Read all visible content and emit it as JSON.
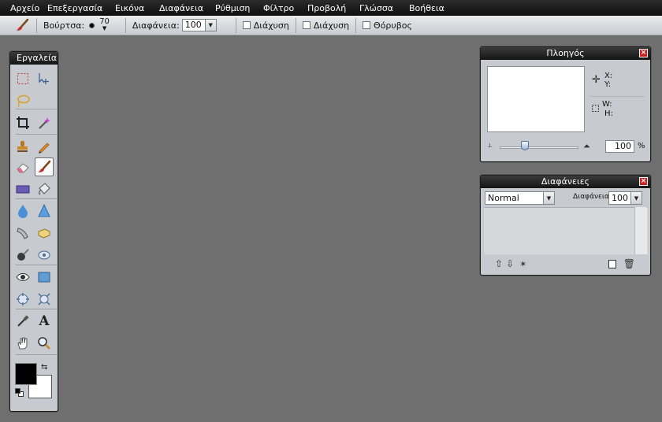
{
  "menu": [
    "Αρχείο",
    "Επεξεργασία",
    "Εικόνα",
    "Διαφάνεια",
    "Ρύθμιση",
    "Φίλτρο",
    "Προβολή",
    "Γλώσσα",
    "Βοήθεια"
  ],
  "options": {
    "brush_label": "Βούρτσα:",
    "brush_size": "70",
    "opacity_label": "Διαφάνεια:",
    "opacity_value": "100",
    "check1": "Διάχυση",
    "check2": "Διάχυση",
    "check3": "Θόρυβος"
  },
  "tools_panel": {
    "title": "Εργαλεία"
  },
  "navigator": {
    "title": "Πλοηγός",
    "x_label": "X:",
    "y_label": "Y:",
    "w_label": "W:",
    "h_label": "H:",
    "zoom_value": "100",
    "zoom_unit": "%"
  },
  "layers": {
    "title": "Διαφάνειες",
    "blend_mode": "Normal",
    "opacity_label": "Διαφάνεια:",
    "opacity_value": "100"
  },
  "colors": {
    "foreground": "#000000",
    "background": "#ffffff"
  }
}
